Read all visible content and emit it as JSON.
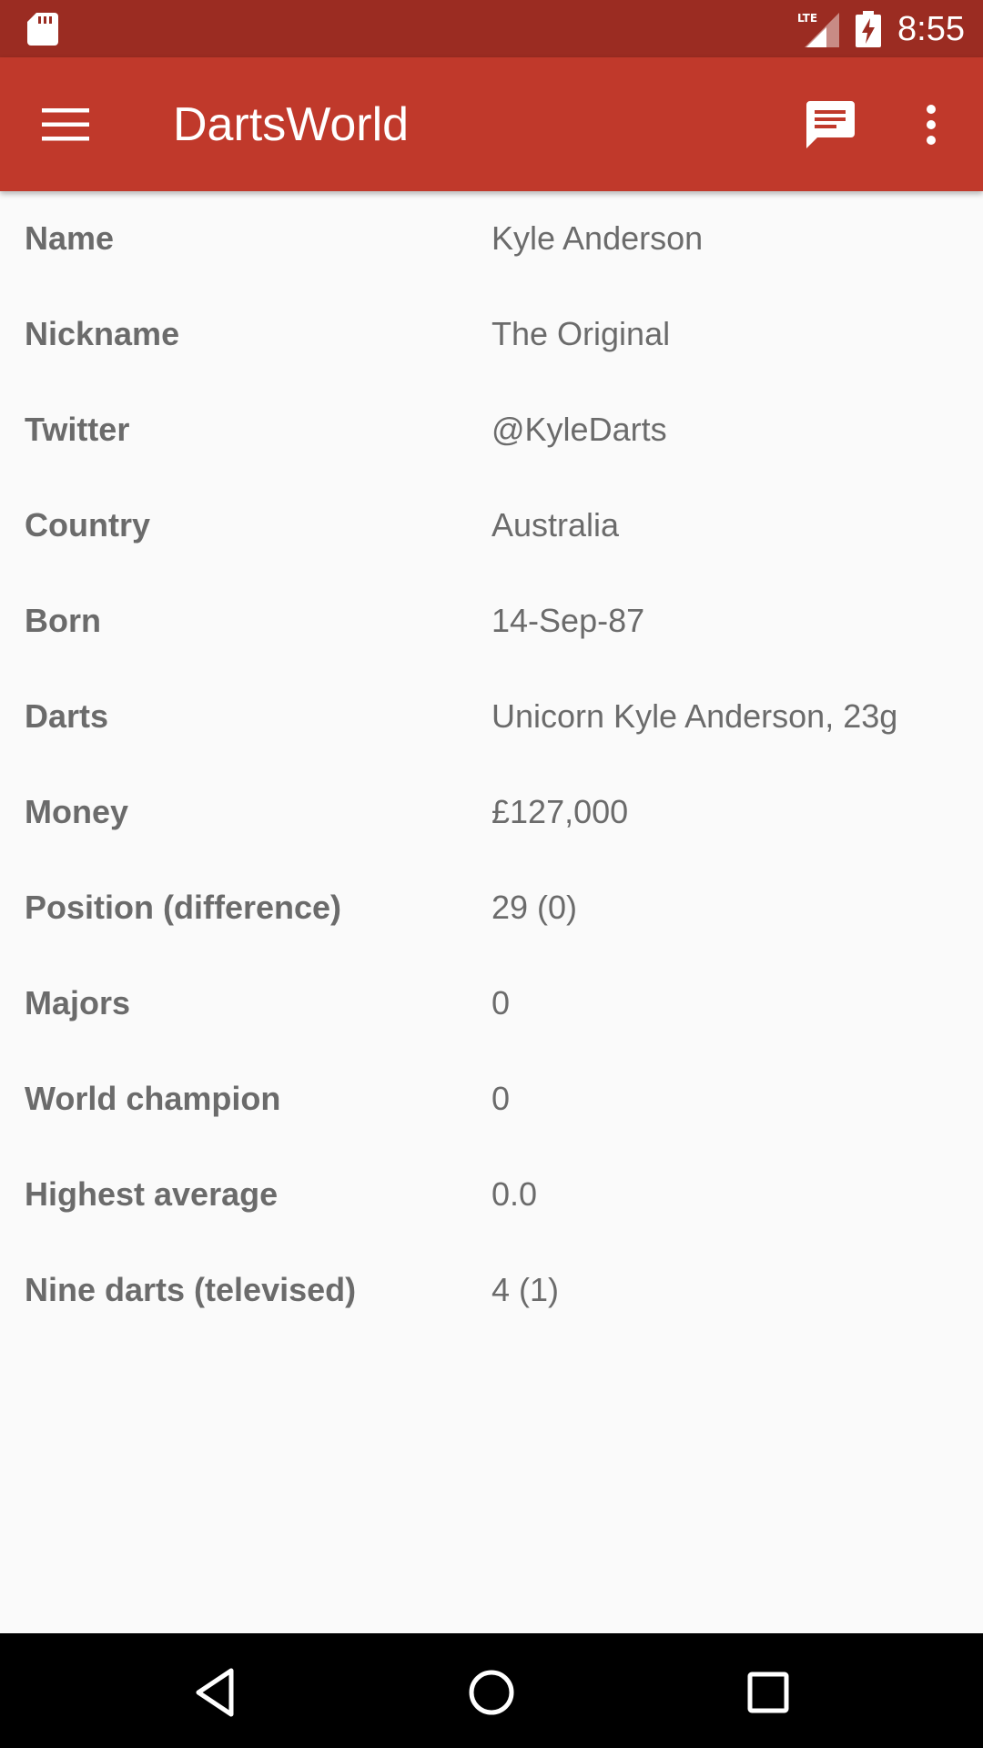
{
  "status_bar": {
    "time": "8:55",
    "network_label": "LTE",
    "icons": [
      "sd-card-icon",
      "lte-signal-icon",
      "battery-charging-icon"
    ]
  },
  "app_bar": {
    "title": "DartsWorld",
    "icons": [
      "menu-icon",
      "chat-icon",
      "overflow-menu-icon"
    ],
    "color": "#c0392b",
    "status_color": "#9b2c22"
  },
  "player": {
    "rows": [
      {
        "label": "Name",
        "value": "Kyle Anderson"
      },
      {
        "label": "Nickname",
        "value": "The Original"
      },
      {
        "label": "Twitter",
        "value": "@KyleDarts"
      },
      {
        "label": "Country",
        "value": "Australia"
      },
      {
        "label": "Born",
        "value": "14-Sep-87"
      },
      {
        "label": "Darts",
        "value": "Unicorn Kyle Anderson, 23g"
      },
      {
        "label": "Money",
        "value": "£127,000"
      },
      {
        "label": "Position (difference)",
        "value": "29 (0)"
      },
      {
        "label": "Majors",
        "value": "0"
      },
      {
        "label": "World champion",
        "value": "0"
      },
      {
        "label": "Highest average",
        "value": "0.0"
      },
      {
        "label": "Nine darts (televised)",
        "value": "4 (1)"
      }
    ]
  },
  "nav_bar": {
    "icons": [
      "back-icon",
      "home-icon",
      "recents-icon"
    ]
  }
}
